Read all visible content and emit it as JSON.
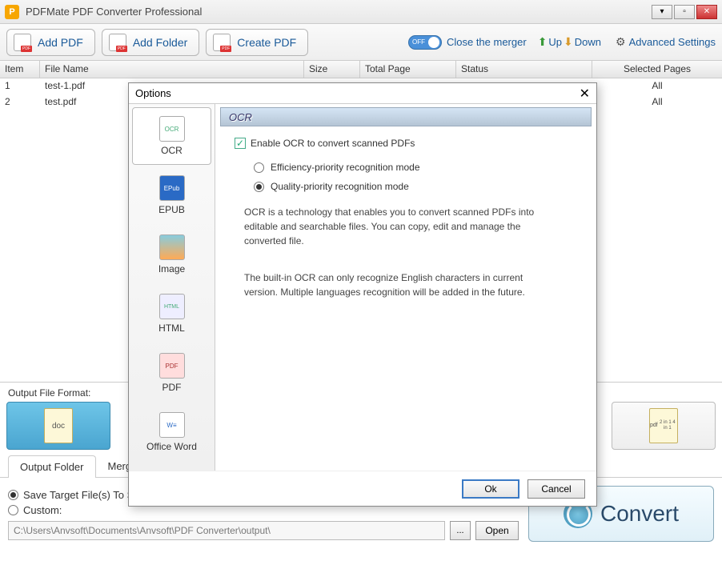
{
  "titlebar": {
    "title": "PDFMate PDF Converter Professional",
    "app_icon_letter": "P"
  },
  "toolbar": {
    "add_pdf": "Add PDF",
    "add_folder": "Add Folder",
    "create_pdf": "Create PDF",
    "toggle_label": "OFF",
    "close_merger": "Close the merger",
    "up": "Up",
    "down": "Down",
    "advanced": "Advanced Settings"
  },
  "table": {
    "headers": {
      "item": "Item",
      "filename": "File Name",
      "size": "Size",
      "totalpage": "Total Page",
      "status": "Status",
      "selected": "Selected Pages"
    },
    "rows": [
      {
        "item": "1",
        "filename": "test-1.pdf",
        "selected": "All"
      },
      {
        "item": "2",
        "filename": "test.pdf",
        "selected": "All"
      }
    ]
  },
  "output_format_label": "Output File Format:",
  "format_tiles": {
    "doc": "doc",
    "pdf_2in1": "pdf",
    "pdf_lines": "2 in 1\n4 in 1"
  },
  "tabs": {
    "output_folder": "Output Folder",
    "merger": "Merger"
  },
  "output_panel": {
    "save_source": "Save Target File(s) To Source Folder.",
    "custom": "Custom:",
    "path": "C:\\Users\\Anvsoft\\Documents\\Anvsoft\\PDF Converter\\output\\",
    "browse": "...",
    "open": "Open"
  },
  "convert_label": "Convert",
  "modal": {
    "title": "Options",
    "close": "✕",
    "sidebar": [
      {
        "label": "OCR"
      },
      {
        "label": "EPUB"
      },
      {
        "label": "Image"
      },
      {
        "label": "HTML"
      },
      {
        "label": "PDF"
      },
      {
        "label": "Office Word"
      }
    ],
    "panel_header": "OCR",
    "enable_ocr": "Enable OCR to convert scanned PDFs",
    "efficiency_mode": "Efficiency-priority recognition mode",
    "quality_mode": "Quality-priority recognition mode",
    "info1": "OCR is a technology that enables you to convert scanned PDFs into editable and searchable files. You can copy, edit and manage the converted file.",
    "info2": "The built-in OCR can only recognize English characters in current version. Multiple languages recognition will be added in the future.",
    "ok": "Ok",
    "cancel": "Cancel"
  }
}
